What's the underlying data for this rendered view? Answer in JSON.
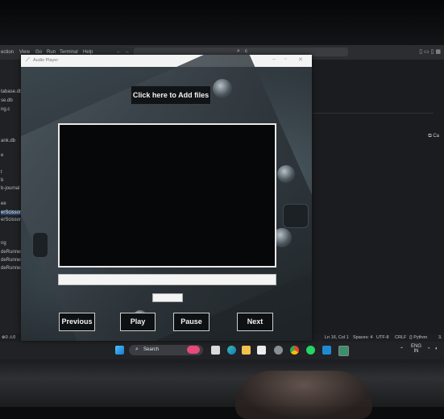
{
  "vscode": {
    "menu": [
      "ection",
      "View",
      "Go",
      "Run",
      "Terminal",
      "Help"
    ],
    "search_text": "c",
    "explorer_files": [
      "tabase.db",
      "se.db",
      "ng.c",
      "ank.db",
      "e",
      "t",
      "b",
      "b-journal",
      "ee",
      "erScissor.c",
      "erScissor.e",
      "ng",
      "deRunnerF",
      "deRunnerF",
      "deRunnerF"
    ],
    "copilot_label": "Ca",
    "status": {
      "left": "⊗0 ⚠0",
      "position": "Ln 16, Col 1",
      "spaces": "Spaces: 4",
      "encoding": "UTF-8",
      "eol": "CRLF",
      "language": "{} Python",
      "version": "3."
    }
  },
  "taskbar": {
    "search_label": "Search",
    "language": "ENG",
    "region": "IN"
  },
  "audio_player": {
    "title": "Audio Player",
    "add_files_label": "Click here to Add files",
    "buttons": {
      "previous": "Previous",
      "play": "Play",
      "pause": "Pause",
      "next": "Next"
    }
  },
  "colors": {
    "vscode_bg": "#1e1f22",
    "taskbar_bg": "#202226",
    "window_titlebar": "#f3f3f3",
    "button_bg": "#0e1113",
    "button_text": "#f3f3f3"
  },
  "icons": [
    "windows-start-icon",
    "search-icon",
    "edge-icon",
    "file-explorer-icon",
    "chrome-icon",
    "whatsapp-icon",
    "vscode-icon",
    "settings-icon"
  ]
}
